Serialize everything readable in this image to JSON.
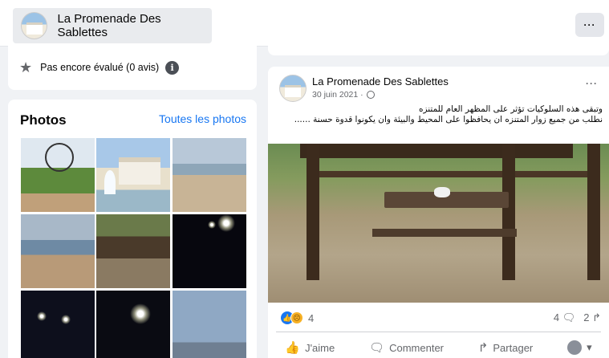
{
  "header": {
    "page_name": "La Promenade Des Sablettes",
    "more_label": "···"
  },
  "rating": {
    "text": "Pas encore évalué (0 avis)",
    "info_label": "i"
  },
  "photos": {
    "title": "Photos",
    "see_all": "Toutes les photos"
  },
  "post": {
    "author": "La Promenade Des Sablettes",
    "date": "30 juin 2021 ·",
    "more_label": "···",
    "text_line1": "وتبقى هذه السلوكيات تؤثر على المظهر العام للمتنزه",
    "text_line2": "نطلب من جميع زوار المتنزه ان يحافظوا على المحيط والبيئة وان يكونوا قدوة حسنة ......",
    "reaction_count": "4",
    "comment_count": "4",
    "share_count": "2",
    "like_label": "J'aime",
    "comment_label": "Commenter",
    "share_label": "Partager"
  }
}
